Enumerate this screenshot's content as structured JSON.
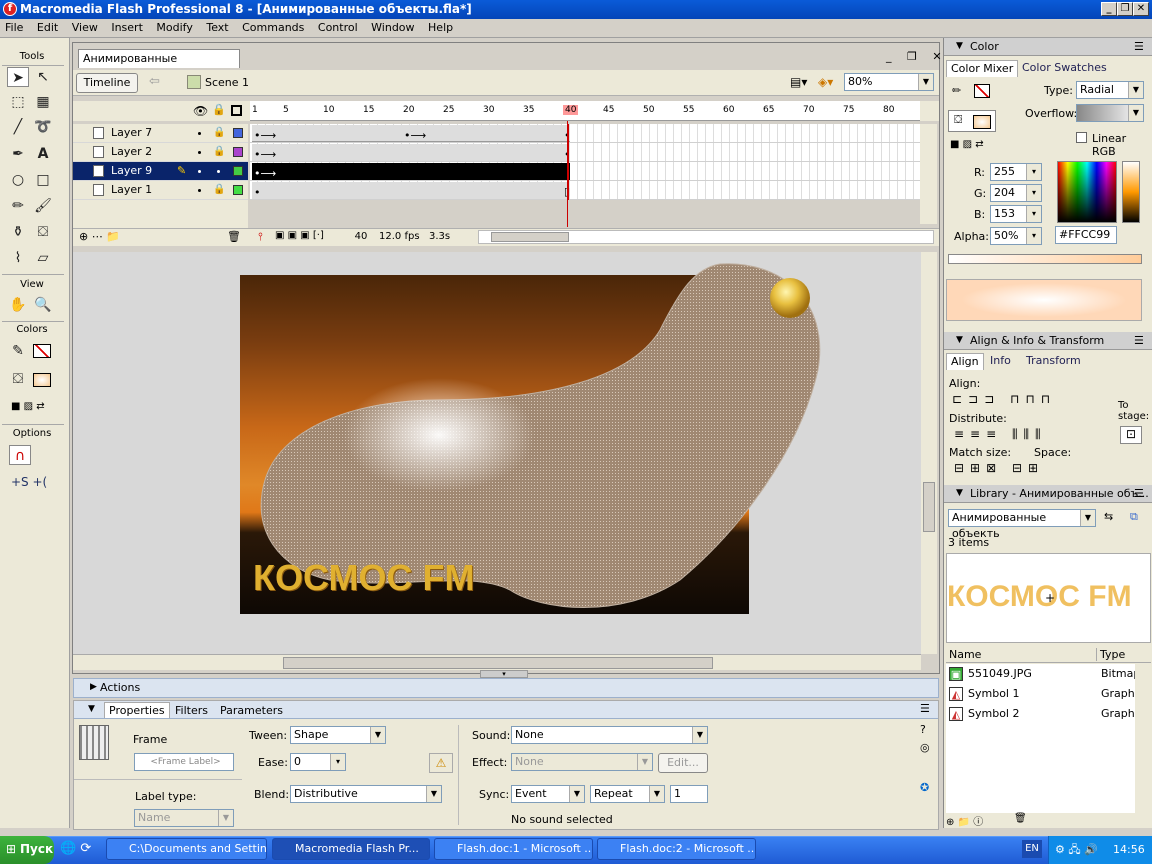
{
  "window": {
    "title": "Macromedia Flash Professional 8 - [Анимированные объекты.fla*]"
  },
  "menu": [
    "File",
    "Edit",
    "View",
    "Insert",
    "Modify",
    "Text",
    "Commands",
    "Control",
    "Window",
    "Help"
  ],
  "tools": {
    "label": "Tools",
    "view_label": "View",
    "colors_label": "Colors",
    "options_label": "Options"
  },
  "document": {
    "tab": "Анимированные объекты.fla*",
    "timeline_button": "Timeline",
    "scene": "Scene 1",
    "zoom": "80%"
  },
  "timeline": {
    "frame_numbers": [
      "1",
      "5",
      "10",
      "15",
      "20",
      "25",
      "30",
      "35",
      "40",
      "45",
      "50",
      "55",
      "60",
      "65",
      "70",
      "75",
      "80"
    ],
    "layers": [
      {
        "name": "Layer 7",
        "color": "#4466dd",
        "selected": false
      },
      {
        "name": "Layer 2",
        "color": "#aa44cc",
        "selected": false
      },
      {
        "name": "Layer 9",
        "color": "#44cc44",
        "selected": true
      },
      {
        "name": "Layer 1",
        "color": "#44dd44",
        "selected": false
      }
    ],
    "current_frame": "40",
    "fps": "12.0 fps",
    "elapsed": "3.3s"
  },
  "stage": {
    "logo_text": "КОСМОС FM"
  },
  "actions_panel": {
    "title": "Actions"
  },
  "properties": {
    "tabs": [
      "Properties",
      "Filters",
      "Parameters"
    ],
    "frame_label": "Frame",
    "frame_label_placeholder": "<Frame Label>",
    "label_type_label": "Label type:",
    "label_type_value": "Name",
    "tween_label": "Tween:",
    "tween_value": "Shape",
    "ease_label": "Ease:",
    "ease_value": "0",
    "blend_label": "Blend:",
    "blend_value": "Distributive",
    "sound_label": "Sound:",
    "sound_value": "None",
    "effect_label": "Effect:",
    "effect_value": "None",
    "edit_button": "Edit...",
    "sync_label": "Sync:",
    "sync_value": "Event",
    "repeat_value": "Repeat",
    "repeat_count": "1",
    "no_sound": "No sound selected"
  },
  "color_panel": {
    "title": "Color",
    "tabs": [
      "Color Mixer",
      "Color Swatches"
    ],
    "type_label": "Type:",
    "type_value": "Radial",
    "overflow_label": "Overflow:",
    "linear_rgb": "Linear RGB",
    "r_label": "R:",
    "r_value": "255",
    "g_label": "G:",
    "g_value": "204",
    "b_label": "B:",
    "b_value": "153",
    "alpha_label": "Alpha:",
    "alpha_value": "50%",
    "hex_value": "#FFCC99"
  },
  "align_panel": {
    "title": "Align & Info & Transform",
    "tabs": [
      "Align",
      "Info",
      "Transform"
    ],
    "align_label": "Align:",
    "distribute_label": "Distribute:",
    "match_label": "Match size:",
    "space_label": "Space:",
    "to_stage": "To stage:"
  },
  "library": {
    "title": "Library - Анимированные объ...",
    "doc_select": "Анимированные объекть",
    "count": "3 items",
    "preview_text": "КОСМОС FM",
    "col_name": "Name",
    "col_type": "Type",
    "items": [
      {
        "name": "551049.JPG",
        "type": "Bitmap"
      },
      {
        "name": "Symbol 1",
        "type": "Graphic"
      },
      {
        "name": "Symbol 2",
        "type": "Graphic"
      }
    ]
  },
  "taskbar": {
    "start": "Пуск",
    "tasks": [
      "C:\\Documents and Settin...",
      "Macromedia Flash Pr...",
      "Flash.doc:1 - Microsoft ...",
      "Flash.doc:2 - Microsoft ..."
    ],
    "lang": "EN",
    "clock": "14:56"
  },
  "colors": {
    "accent": "#0a246a",
    "titlebar": "#0a5bd8",
    "playhead": "#cc0000"
  }
}
